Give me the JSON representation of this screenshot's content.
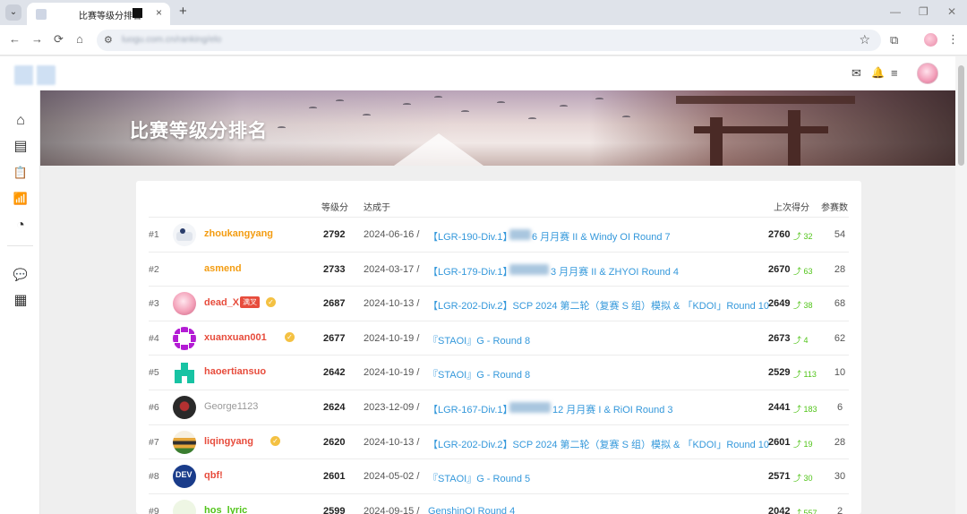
{
  "browser": {
    "tab_title": "比赛等级分排名",
    "tab_close": "×",
    "new_tab": "+",
    "menu_glyph": "⌄",
    "url": "luogu.com.cn/ranking/elo",
    "nav": {
      "back": "←",
      "forward": "→",
      "reload": "⟳",
      "home": "⌂",
      "star": "☆",
      "extensions": "⧉",
      "menu": "⋮"
    },
    "window": {
      "minimize": "—",
      "restore": "❐",
      "close": "✕"
    }
  },
  "header": {
    "icons": {
      "mail": "✉",
      "bell": "🔔",
      "settings": "≡"
    }
  },
  "sidebar": {
    "icons": [
      "home-icon",
      "book-icon",
      "clipboard-icon",
      "ranking-icon",
      "chart-icon",
      "discuss-icon",
      "news-icon"
    ],
    "glyphs": [
      "⌂",
      "▤",
      "📋",
      "📶",
      "◔",
      "💬",
      "▦"
    ]
  },
  "banner": {
    "title": "比赛等级分排名"
  },
  "table": {
    "headers": {
      "score": "等级分",
      "achieved": "达成于",
      "last": "上次得分",
      "count": "参赛数"
    },
    "rows": [
      {
        "rank": "#1",
        "name": "zhoukangyang",
        "color": "orange",
        "score": "2792",
        "date": "2024-06-16 /",
        "contest_pre": "【LGR-190-Div.1】",
        "contest_post": "6 月月赛 II & Windy OI Round 7",
        "last": "2760",
        "delta": "⤴ 32",
        "count": "54"
      },
      {
        "rank": "#2",
        "name": "asmend",
        "color": "orange",
        "score": "2733",
        "date": "2024-03-17 /",
        "contest_pre": "【LGR-179-Div.1】",
        "contest_post": "3 月月赛 II & ZHYOI Round 4",
        "last": "2670",
        "delta": "⤴ 63",
        "count": "28"
      },
      {
        "rank": "#3",
        "name": "dead_X",
        "color": "red",
        "badge": "满叉",
        "score": "2687",
        "date": "2024-10-13 /",
        "contest_pre": "【LGR-202-Div.2】SCP 2024 第二轮（复赛 S 组）模拟 & 「KDOI」Round 10",
        "contest_post": "",
        "last": "2649",
        "delta": "⤴ 38",
        "count": "68"
      },
      {
        "rank": "#4",
        "name": "xuanxuan001",
        "color": "red",
        "score": "2677",
        "date": "2024-10-19 /",
        "contest_pre": "『STAOI』G - Round 8",
        "contest_post": "",
        "last": "2673",
        "delta": "⤴ 4",
        "count": "62"
      },
      {
        "rank": "#5",
        "name": "haoertiansuo",
        "color": "red",
        "score": "2642",
        "date": "2024-10-19 /",
        "contest_pre": "『STAOI』G - Round 8",
        "contest_post": "",
        "last": "2529",
        "delta": "⤴ 113",
        "count": "10"
      },
      {
        "rank": "#6",
        "name": "George1123",
        "color": "gray",
        "score": "2624",
        "date": "2023-12-09 /",
        "contest_pre": "【LGR-167-Div.1】",
        "contest_post": "12 月月赛 I & RiOI Round 3",
        "last": "2441",
        "delta": "⤴ 183",
        "count": "6"
      },
      {
        "rank": "#7",
        "name": "liqingyang",
        "color": "red",
        "score": "2620",
        "date": "2024-10-13 /",
        "contest_pre": "【LGR-202-Div.2】SCP 2024 第二轮（复赛 S 组）模拟 & 「KDOI」Round 10",
        "contest_post": "",
        "last": "2601",
        "delta": "⤴ 19",
        "count": "28"
      },
      {
        "rank": "#8",
        "name": "qbf!",
        "color": "red",
        "score": "2601",
        "date": "2024-05-02 /",
        "contest_pre": "『STAOI』G - Round 5",
        "contest_post": "",
        "last": "2571",
        "delta": "⤴ 30",
        "count": "30"
      },
      {
        "rank": "#9",
        "name": "hos_lyric",
        "color": "green",
        "score": "2599",
        "date": "2024-09-15 /",
        "contest_pre": "GenshinOI Round 4",
        "contest_post": "",
        "last": "2042",
        "delta": "⤴ 557",
        "count": "2"
      }
    ]
  }
}
